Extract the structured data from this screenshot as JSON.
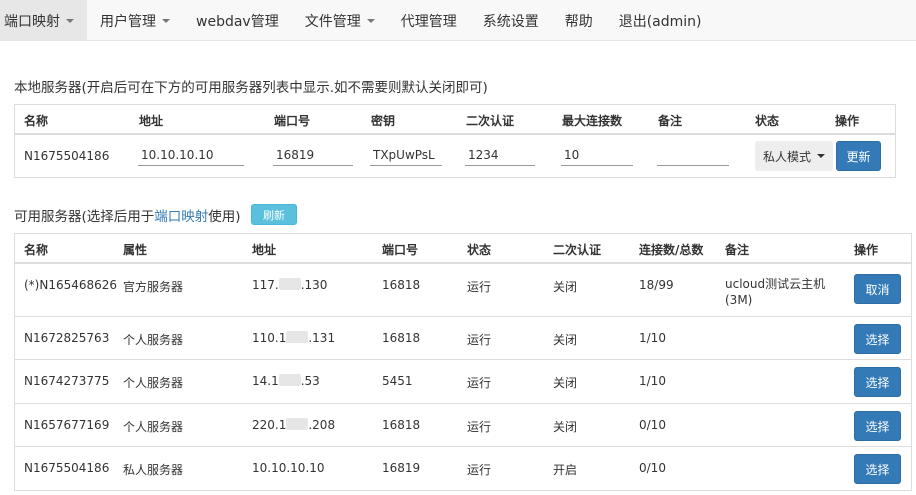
{
  "nav": {
    "items": [
      {
        "label": "端口映射",
        "caret": true,
        "active": true
      },
      {
        "label": "用户管理",
        "caret": true
      },
      {
        "label": "webdav管理"
      },
      {
        "label": "文件管理",
        "caret": true
      },
      {
        "label": "代理管理"
      },
      {
        "label": "系统设置"
      },
      {
        "label": "帮助"
      },
      {
        "label": "退出(admin)"
      }
    ]
  },
  "local": {
    "title": "本地服务器(开启后可在下方的可用服务器列表中显示.如不需要则默认关闭即可)",
    "headers": [
      "名称",
      "地址",
      "端口号",
      "密钥",
      "二次认证",
      "最大连接数",
      "备注",
      "状态",
      "操作"
    ],
    "row": {
      "name": "N1675504186",
      "address": "10.10.10.10",
      "port": "16819",
      "key": "TXpUwPsL",
      "auth": "1234",
      "max_conn": "10",
      "note": "",
      "status": "私人模式",
      "action": "更新"
    }
  },
  "avail": {
    "title_prefix": "可用服务器(选择后用于",
    "title_link": "端口映射",
    "title_suffix": "使用)",
    "refresh": "刷新",
    "headers": [
      "名称",
      "属性",
      "地址",
      "端口号",
      "状态",
      "二次认证",
      "连接数/总数",
      "备注",
      "操作"
    ],
    "rows": [
      {
        "name": "(*)N165468626",
        "type": "官方服务器",
        "addr_a": "117.",
        "addr_b": ".130",
        "port": "16818",
        "status": "运行",
        "auth": "关闭",
        "conn": "18/99",
        "note": "ucloud测试云主机(3M)",
        "action": "取消"
      },
      {
        "name": "N1672825763",
        "type": "个人服务器",
        "addr_a": "110.1",
        "addr_b": ".131",
        "port": "16818",
        "status": "运行",
        "auth": "关闭",
        "conn": "1/10",
        "note": "",
        "action": "选择"
      },
      {
        "name": "N1674273775",
        "type": "个人服务器",
        "addr_a": "14.1",
        "addr_b": ".53",
        "port": "5451",
        "status": "运行",
        "auth": "关闭",
        "conn": "1/10",
        "note": "",
        "action": "选择"
      },
      {
        "name": "N1657677169",
        "type": "个人服务器",
        "addr_a": "220.1",
        "addr_b": ".208",
        "port": "16818",
        "status": "运行",
        "auth": "关闭",
        "conn": "0/10",
        "note": "",
        "action": "选择"
      },
      {
        "name": "N1675504186",
        "type": "私人服务器",
        "addr_a": "10.10.10.10",
        "addr_b": "",
        "port": "16819",
        "status": "运行",
        "auth": "开启",
        "conn": "0/10",
        "note": "",
        "action": "选择"
      }
    ]
  },
  "colors": {
    "primary": "#337ab7",
    "info": "#5bc0de",
    "navbar": "#f8f8f8"
  }
}
